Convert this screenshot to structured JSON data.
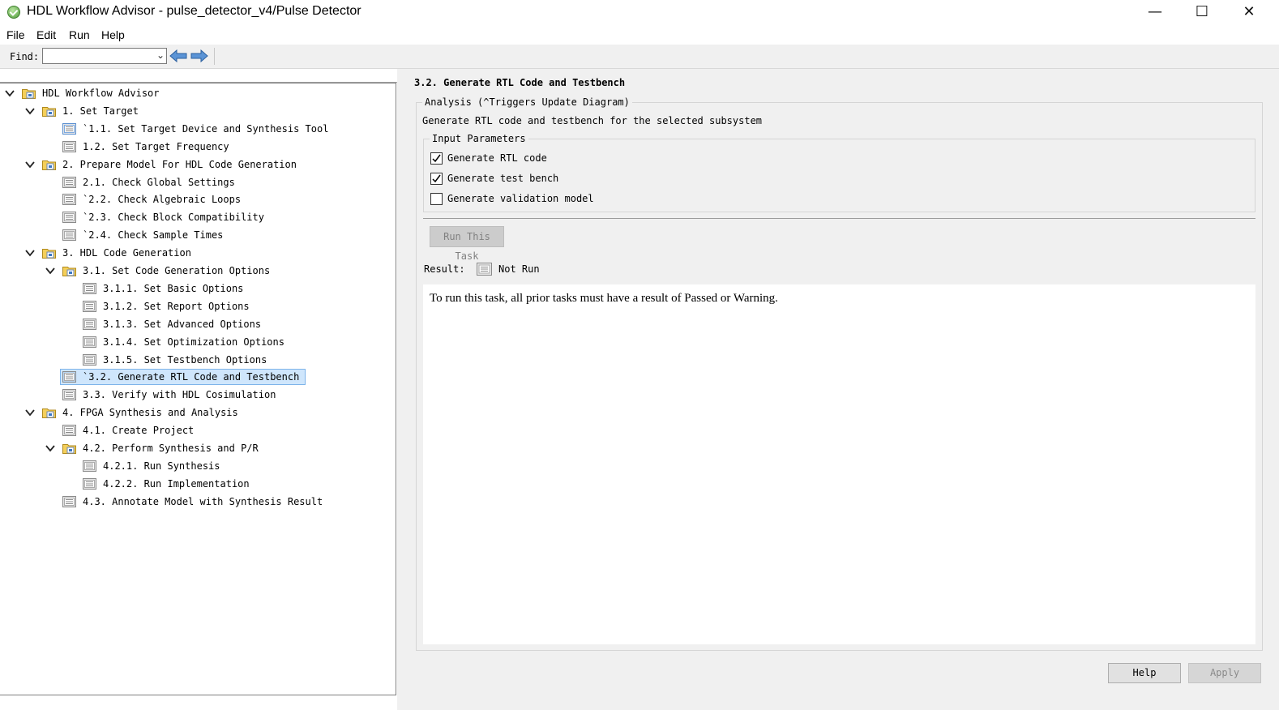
{
  "window": {
    "title": "HDL Workflow Advisor - pulse_detector_v4/Pulse Detector",
    "controls": {
      "minimize": "—",
      "maximize": "☐",
      "close": "✕"
    }
  },
  "menu": [
    "File",
    "Edit",
    "Run",
    "Help"
  ],
  "toolbar": {
    "find_label": "Find:",
    "find_value": "",
    "dropdown_icon": "⌄",
    "icons": [
      "back-arrow-icon",
      "forward-arrow-icon"
    ]
  },
  "tree": {
    "items": [
      {
        "label": "HDL Workflow Advisor",
        "level": 0,
        "type": "folder",
        "expanded": true
      },
      {
        "label": "1. Set Target",
        "level": 1,
        "type": "folder",
        "expanded": true
      },
      {
        "label": "`1.1. Set Target Device and Synthesis Tool",
        "level": 2,
        "type": "task"
      },
      {
        "label": "1.2. Set Target Frequency",
        "level": 2,
        "type": "task"
      },
      {
        "label": "2. Prepare Model For HDL Code Generation",
        "level": 1,
        "type": "folder",
        "expanded": true
      },
      {
        "label": "2.1. Check Global Settings",
        "level": 2,
        "type": "task"
      },
      {
        "label": "`2.2. Check Algebraic Loops",
        "level": 2,
        "type": "task"
      },
      {
        "label": "`2.3. Check Block Compatibility",
        "level": 2,
        "type": "task"
      },
      {
        "label": "`2.4. Check Sample Times",
        "level": 2,
        "type": "task"
      },
      {
        "label": "3. HDL Code Generation",
        "level": 1,
        "type": "folder",
        "expanded": true
      },
      {
        "label": "3.1. Set Code Generation Options",
        "level": 2,
        "type": "folder",
        "expanded": true
      },
      {
        "label": "3.1.1. Set Basic Options",
        "level": 3,
        "type": "task"
      },
      {
        "label": "3.1.2. Set Report Options",
        "level": 3,
        "type": "task"
      },
      {
        "label": "3.1.3. Set Advanced Options",
        "level": 3,
        "type": "task"
      },
      {
        "label": "3.1.4. Set Optimization Options",
        "level": 3,
        "type": "task"
      },
      {
        "label": "3.1.5. Set Testbench Options",
        "level": 3,
        "type": "task"
      },
      {
        "label": "`3.2. Generate RTL Code and Testbench",
        "level": 2,
        "type": "task",
        "selected": true
      },
      {
        "label": "3.3. Verify with HDL Cosimulation",
        "level": 2,
        "type": "task"
      },
      {
        "label": "4. FPGA Synthesis and Analysis",
        "level": 1,
        "type": "folder",
        "expanded": true
      },
      {
        "label": "4.1. Create Project",
        "level": 2,
        "type": "task"
      },
      {
        "label": "4.2. Perform Synthesis and P/R",
        "level": 2,
        "type": "folder",
        "expanded": true
      },
      {
        "label": "4.2.1. Run Synthesis",
        "level": 3,
        "type": "task"
      },
      {
        "label": "4.2.2. Run Implementation",
        "level": 3,
        "type": "task"
      },
      {
        "label": "4.3. Annotate Model with Synthesis Result",
        "level": 2,
        "type": "task"
      }
    ]
  },
  "task": {
    "title": "3.2. Generate RTL Code and Testbench",
    "analysis_legend": "Analysis (^Triggers Update Diagram)",
    "description": "Generate RTL code and testbench for the selected subsystem",
    "input_legend": "Input Parameters",
    "params": [
      {
        "label": "Generate RTL code",
        "checked": true
      },
      {
        "label": "Generate test bench",
        "checked": true
      },
      {
        "label": "Generate validation model",
        "checked": false
      }
    ],
    "run_button": "Run This Task",
    "result_label": "Result:",
    "result_value": "Not Run",
    "result_message": "To run this task, all prior tasks must have a result of Passed or Warning."
  },
  "footer": {
    "help": "Help",
    "apply": "Apply"
  },
  "colors": {
    "selection_bg": "#cfe6fc",
    "selection_border": "#7eb4ea",
    "panel_bg": "#f0f0f0",
    "arrow_blue": "#3a78c4"
  }
}
